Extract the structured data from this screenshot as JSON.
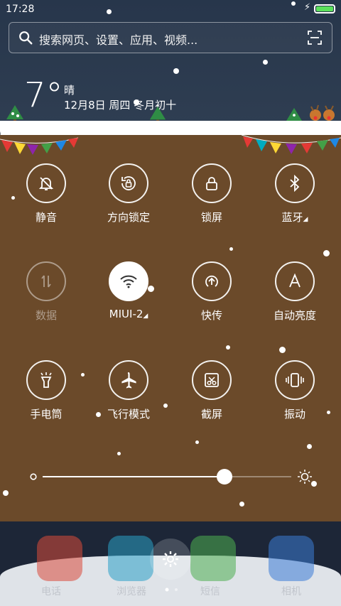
{
  "status_bar": {
    "time": "17:28",
    "battery_color": "#5be15b"
  },
  "search": {
    "placeholder": "搜索网页、设置、应用、视频..."
  },
  "weather": {
    "temperature": "7°",
    "condition": "晴",
    "date": "12月8日 周四 冬月初十"
  },
  "toggles": [
    {
      "label": "静音",
      "icon": "bell-off-icon",
      "state": "off"
    },
    {
      "label": "方向锁定",
      "icon": "rotation-lock-icon",
      "state": "off"
    },
    {
      "label": "锁屏",
      "icon": "lock-icon",
      "state": "off"
    },
    {
      "label": "蓝牙",
      "icon": "bluetooth-icon",
      "state": "off"
    },
    {
      "label": "数据",
      "icon": "mobile-data-icon",
      "state": "disabled"
    },
    {
      "label": "MIUI-2",
      "icon": "wifi-icon",
      "state": "on"
    },
    {
      "label": "快传",
      "icon": "transfer-icon",
      "state": "off"
    },
    {
      "label": "自动亮度",
      "icon": "auto-brightness-icon",
      "state": "off"
    },
    {
      "label": "手电筒",
      "icon": "flashlight-icon",
      "state": "off"
    },
    {
      "label": "飞行模式",
      "icon": "airplane-icon",
      "state": "off"
    },
    {
      "label": "截屏",
      "icon": "screenshot-icon",
      "state": "off"
    },
    {
      "label": "振动",
      "icon": "vibrate-icon",
      "state": "off"
    }
  ],
  "brightness": {
    "level": 0.73
  },
  "dock": {
    "apps": [
      "电话",
      "浏览器",
      "短信",
      "相机"
    ]
  },
  "colors": {
    "panel": "#6b4a2a",
    "header": "#27364b"
  }
}
